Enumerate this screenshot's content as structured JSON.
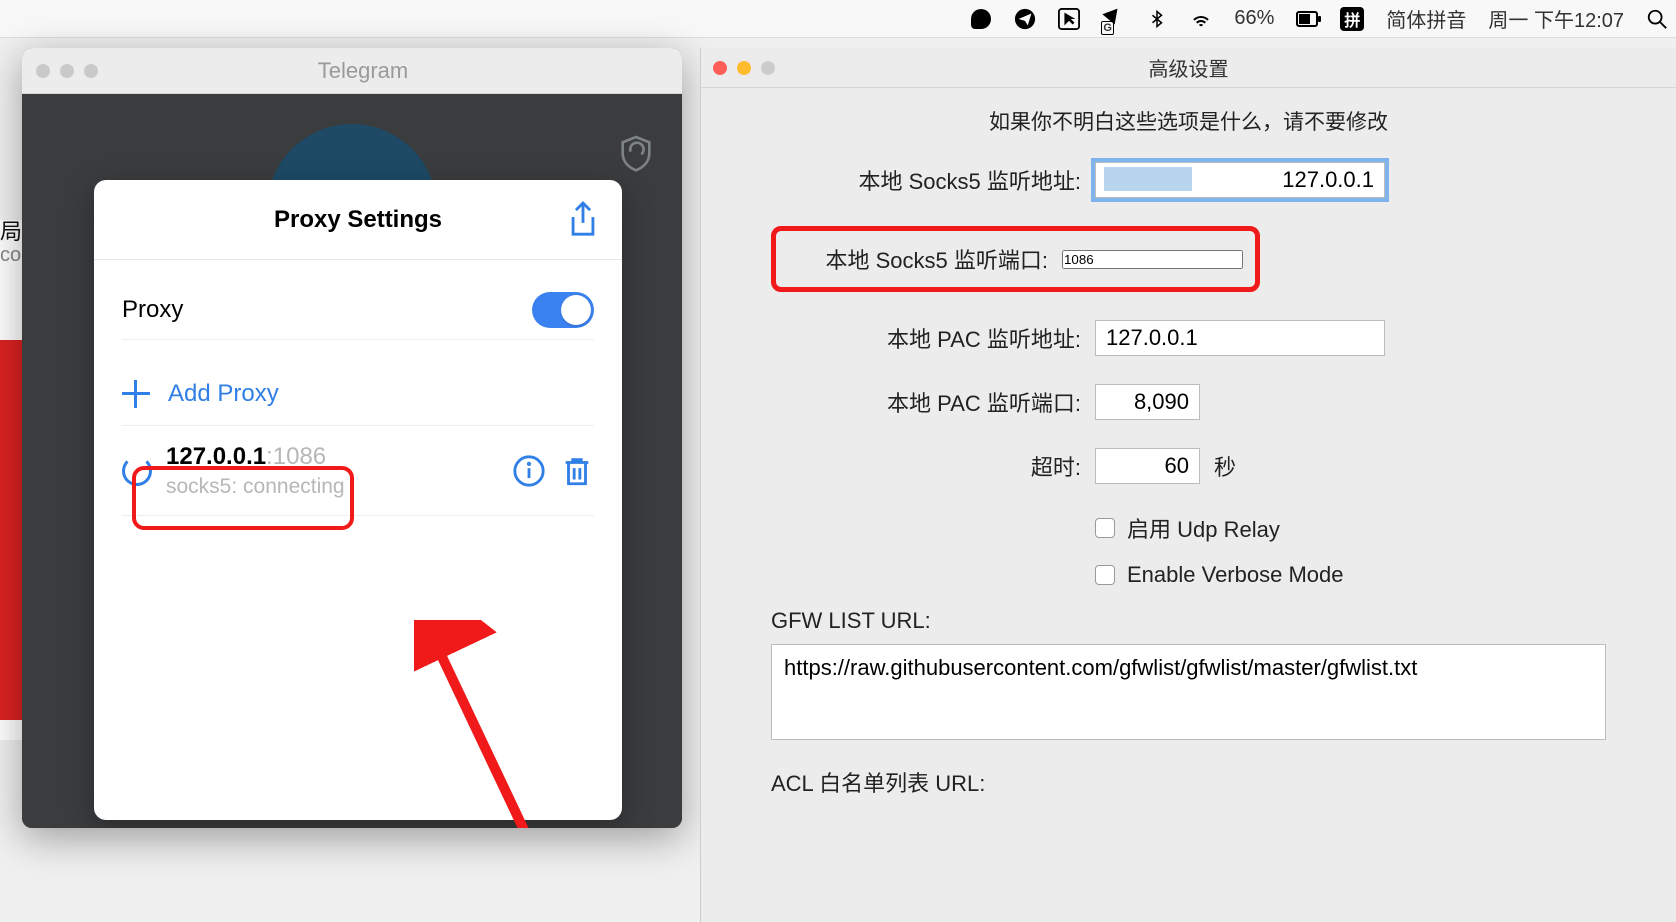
{
  "menubar": {
    "battery_pct": "66%",
    "ime_badge": "拼",
    "ime_label": "简体拼音",
    "clock": "周一 下午12:07"
  },
  "bg_left": {
    "line1": "局",
    "line2": "co"
  },
  "telegram": {
    "window_title": "Telegram",
    "sheet_title": "Proxy Settings",
    "proxy_label": "Proxy",
    "add_proxy": "Add Proxy",
    "proxy_ip": "127.0.0.1",
    "proxy_port": ":1086",
    "proxy_status": "socks5: connecting"
  },
  "advanced": {
    "title": "高级设置",
    "warning": "如果你不明白这些选项是什么，请不要修改",
    "socks5_addr_label": "本地 Socks5 监听地址:",
    "socks5_addr_value": "127.0.0.1",
    "socks5_port_label": "本地 Socks5 监听端口:",
    "socks5_port_value": "1086",
    "pac_addr_label": "本地 PAC 监听地址:",
    "pac_addr_value": "127.0.0.1",
    "pac_port_label": "本地 PAC 监听端口:",
    "pac_port_value": "8,090",
    "timeout_label": "超时:",
    "timeout_value": "60",
    "timeout_unit": "秒",
    "udp_relay_label": "启用 Udp Relay",
    "verbose_label": "Enable Verbose Mode",
    "gfw_label": "GFW LIST URL:",
    "gfw_value": "https://raw.githubusercontent.com/gfwlist/gfwlist/master/gfwlist.txt",
    "acl_label": "ACL 白名单列表 URL:"
  }
}
